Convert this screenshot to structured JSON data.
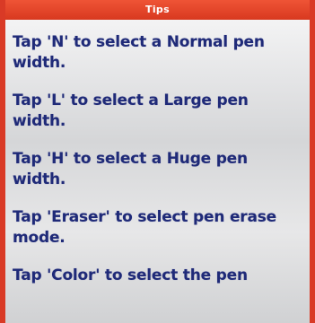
{
  "header": {
    "title": "Tips"
  },
  "tips": [
    "Tap 'N' to select a Normal pen width.",
    "Tap 'L' to select a Large pen width.",
    "Tap 'H' to select a Huge pen width.",
    "Tap 'Eraser' to select pen erase mode.",
    "Tap 'Color' to select the pen"
  ],
  "colors": {
    "frame": "#d93a26",
    "header_bg": "#e4462b",
    "header_text": "#ffffff",
    "tip_text": "#1f2a78"
  }
}
